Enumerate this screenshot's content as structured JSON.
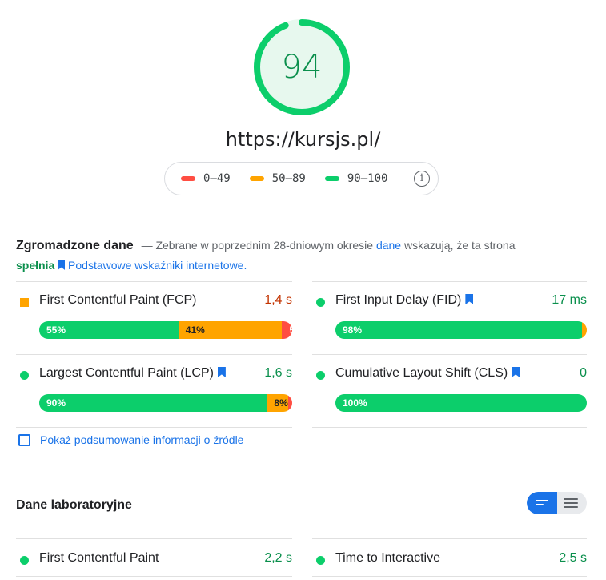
{
  "score": {
    "value": "94",
    "fraction": 0.94,
    "color": "#0cce6b"
  },
  "url": "https://kursjs.pl/",
  "legend": {
    "items": [
      {
        "label": "0–49",
        "color": "#ff4e42"
      },
      {
        "label": "50–89",
        "color": "#ffa400"
      },
      {
        "label": "90–100",
        "color": "#0cce6b"
      }
    ],
    "info_icon": "info-icon",
    "info_glyph": "i"
  },
  "field_data": {
    "title": "Zgromadzone dane",
    "desc_prefix": "— Zebrane w poprzednim 28-dniowym okresie",
    "desc_link": "dane",
    "desc_mid": "wskazują, że ta strona",
    "desc_pass": "spełnia",
    "desc_cwv_link": "Podstawowe wskaźniki internetowe.",
    "metrics": [
      {
        "name": "First Contentful Paint (FCP)",
        "value": "1,4 s",
        "status": "average",
        "core": false,
        "distribution": [
          {
            "label": "55%",
            "pct": 55
          },
          {
            "label": "41%",
            "pct": 41
          },
          {
            "label": "5%",
            "pct": 5
          }
        ]
      },
      {
        "name": "First Input Delay (FID)",
        "value": "17 ms",
        "status": "good",
        "core": true,
        "distribution": [
          {
            "label": "98%",
            "pct": 98
          },
          {
            "label": "1%",
            "pct": 1
          },
          {
            "label": "",
            "pct": 0
          }
        ]
      },
      {
        "name": "Largest Contentful Paint (LCP)",
        "value": "1,6 s",
        "status": "good",
        "core": true,
        "distribution": [
          {
            "label": "90%",
            "pct": 90
          },
          {
            "label": "8%",
            "pct": 8
          },
          {
            "label": "2%",
            "pct": 2
          }
        ]
      },
      {
        "name": "Cumulative Layout Shift (CLS)",
        "value": "0",
        "status": "good",
        "core": true,
        "distribution": [
          {
            "label": "100%",
            "pct": 100
          },
          {
            "label": "",
            "pct": 0
          },
          {
            "label": "",
            "pct": 0
          }
        ]
      }
    ]
  },
  "origin_summary": {
    "label": "Pokaż podsumowanie informacji o źródle",
    "checked": false
  },
  "lab_data": {
    "title": "Dane laboratoryjne",
    "toggle": {
      "selected": "expanded",
      "icons": [
        "view-expanded-icon",
        "view-list-icon"
      ]
    },
    "metrics": [
      {
        "name": "First Contentful Paint",
        "value": "2,2 s",
        "status": "good"
      },
      {
        "name": "Time to Interactive",
        "value": "2,5 s",
        "status": "good"
      }
    ]
  },
  "colors": {
    "good": "#0cce6b",
    "good_text": "#0a8f4c",
    "average": "#ffa400",
    "average_text": "#c33300",
    "poor": "#ff4e42",
    "link": "#1a73e8"
  }
}
